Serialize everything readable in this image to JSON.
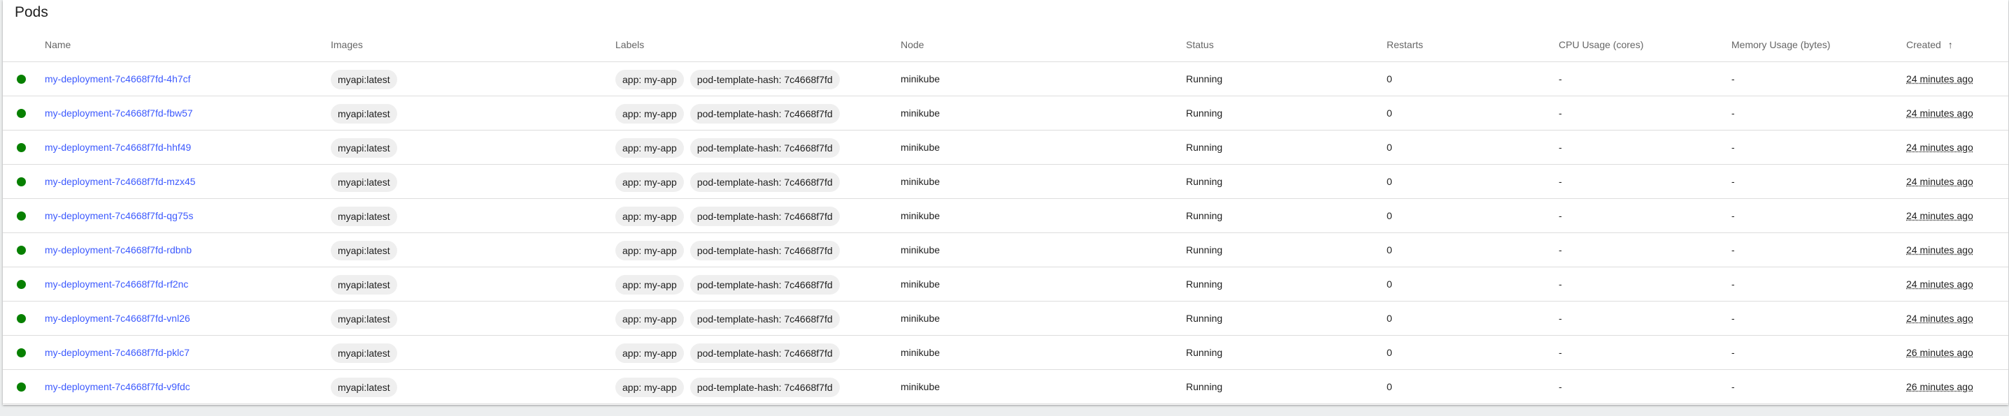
{
  "title": "Pods",
  "columns": {
    "name": "Name",
    "images": "Images",
    "labels": "Labels",
    "node": "Node",
    "status": "Status",
    "restarts": "Restarts",
    "cpu": "CPU Usage (cores)",
    "memory": "Memory Usage (bytes)",
    "created": "Created",
    "created_sort_icon": "↑"
  },
  "colors": {
    "status_running": "#078000",
    "link": "#3d5afe"
  },
  "pods": [
    {
      "name": "my-deployment-7c4668f7fd-4h7cf",
      "image": "myapi:latest",
      "labels": [
        "app: my-app",
        "pod-template-hash: 7c4668f7fd"
      ],
      "node": "minikube",
      "status": "Running",
      "restarts": "0",
      "cpu": "-",
      "memory": "-",
      "created": "24 minutes ago"
    },
    {
      "name": "my-deployment-7c4668f7fd-fbw57",
      "image": "myapi:latest",
      "labels": [
        "app: my-app",
        "pod-template-hash: 7c4668f7fd"
      ],
      "node": "minikube",
      "status": "Running",
      "restarts": "0",
      "cpu": "-",
      "memory": "-",
      "created": "24 minutes ago"
    },
    {
      "name": "my-deployment-7c4668f7fd-hhf49",
      "image": "myapi:latest",
      "labels": [
        "app: my-app",
        "pod-template-hash: 7c4668f7fd"
      ],
      "node": "minikube",
      "status": "Running",
      "restarts": "0",
      "cpu": "-",
      "memory": "-",
      "created": "24 minutes ago"
    },
    {
      "name": "my-deployment-7c4668f7fd-mzx45",
      "image": "myapi:latest",
      "labels": [
        "app: my-app",
        "pod-template-hash: 7c4668f7fd"
      ],
      "node": "minikube",
      "status": "Running",
      "restarts": "0",
      "cpu": "-",
      "memory": "-",
      "created": "24 minutes ago"
    },
    {
      "name": "my-deployment-7c4668f7fd-qg75s",
      "image": "myapi:latest",
      "labels": [
        "app: my-app",
        "pod-template-hash: 7c4668f7fd"
      ],
      "node": "minikube",
      "status": "Running",
      "restarts": "0",
      "cpu": "-",
      "memory": "-",
      "created": "24 minutes ago"
    },
    {
      "name": "my-deployment-7c4668f7fd-rdbnb",
      "image": "myapi:latest",
      "labels": [
        "app: my-app",
        "pod-template-hash: 7c4668f7fd"
      ],
      "node": "minikube",
      "status": "Running",
      "restarts": "0",
      "cpu": "-",
      "memory": "-",
      "created": "24 minutes ago"
    },
    {
      "name": "my-deployment-7c4668f7fd-rf2nc",
      "image": "myapi:latest",
      "labels": [
        "app: my-app",
        "pod-template-hash: 7c4668f7fd"
      ],
      "node": "minikube",
      "status": "Running",
      "restarts": "0",
      "cpu": "-",
      "memory": "-",
      "created": "24 minutes ago"
    },
    {
      "name": "my-deployment-7c4668f7fd-vnl26",
      "image": "myapi:latest",
      "labels": [
        "app: my-app",
        "pod-template-hash: 7c4668f7fd"
      ],
      "node": "minikube",
      "status": "Running",
      "restarts": "0",
      "cpu": "-",
      "memory": "-",
      "created": "24 minutes ago"
    },
    {
      "name": "my-deployment-7c4668f7fd-pklc7",
      "image": "myapi:latest",
      "labels": [
        "app: my-app",
        "pod-template-hash: 7c4668f7fd"
      ],
      "node": "minikube",
      "status": "Running",
      "restarts": "0",
      "cpu": "-",
      "memory": "-",
      "created": "26 minutes ago"
    },
    {
      "name": "my-deployment-7c4668f7fd-v9fdc",
      "image": "myapi:latest",
      "labels": [
        "app: my-app",
        "pod-template-hash: 7c4668f7fd"
      ],
      "node": "minikube",
      "status": "Running",
      "restarts": "0",
      "cpu": "-",
      "memory": "-",
      "created": "26 minutes ago"
    }
  ]
}
